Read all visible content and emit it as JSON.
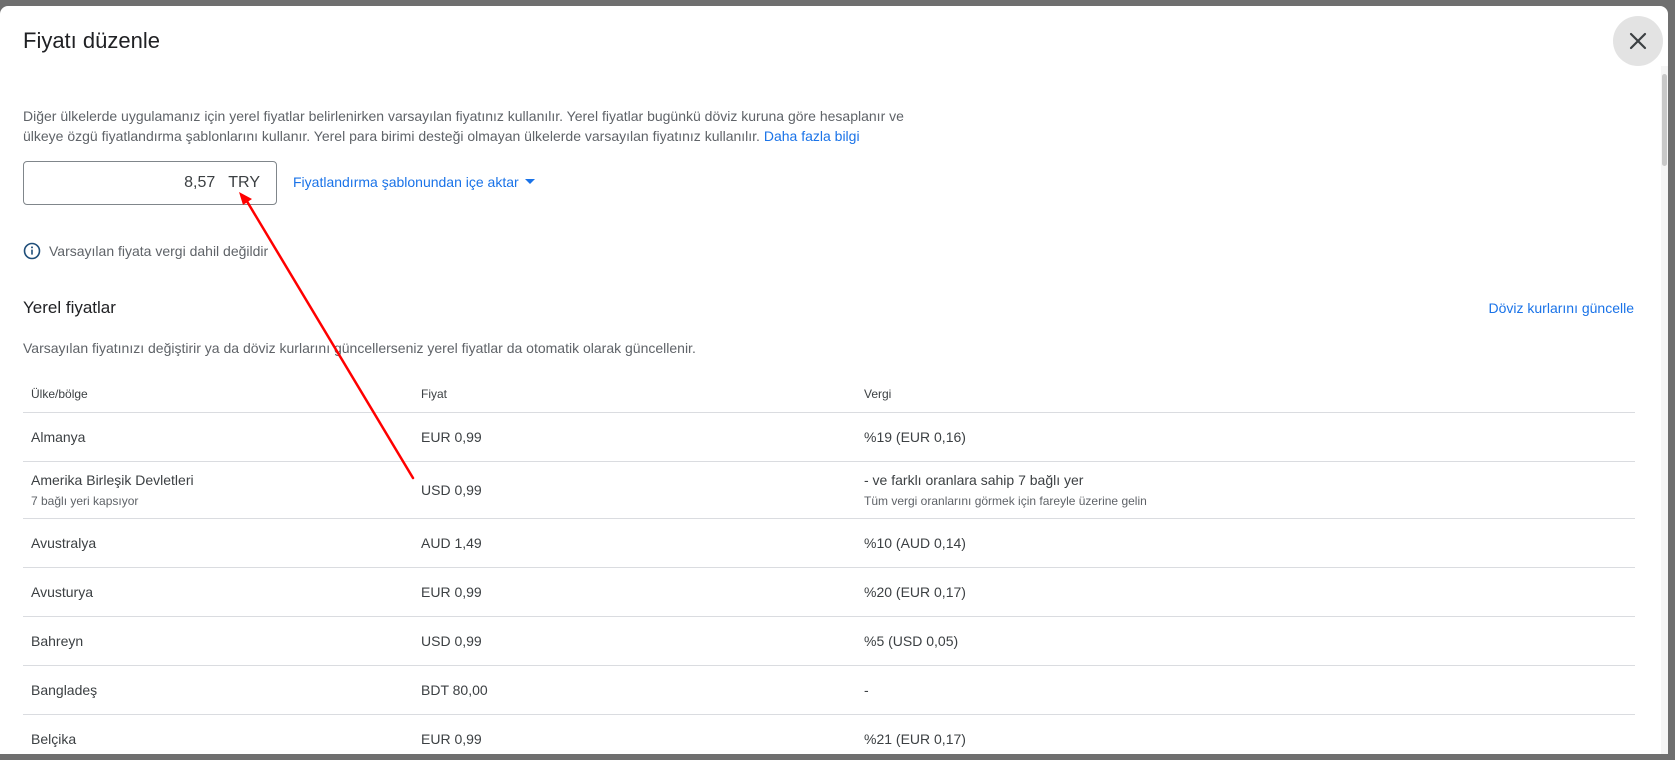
{
  "dialog": {
    "title": "Fiyatı düzenle",
    "description": "Diğer ülkelerde uygulamanız için yerel fiyatlar belirlenirken varsayılan fiyatınız kullanılır. Yerel fiyatlar bugünkü döviz kuruna göre hesaplanır ve ülkeye özgü fiyatlandırma şablonlarını kullanır. Yerel para birimi desteği olmayan ülkelerde varsayılan fiyatınız kullanılır.",
    "learn_more": "Daha fazla bilgi",
    "price_value": "8,57",
    "currency": "TRY",
    "import_template": "Fiyatlandırma şablonundan içe aktar",
    "tax_note": "Varsayılan fiyata vergi dahil değildir"
  },
  "local_prices": {
    "title": "Yerel fiyatlar",
    "update_rates": "Döviz kurlarını güncelle",
    "description": "Varsayılan fiyatınızı değiştirir ya da döviz kurlarını güncellerseniz yerel fiyatlar da otomatik olarak güncellenir.",
    "headers": [
      "Ülke/bölge",
      "Fiyat",
      "Vergi"
    ],
    "rows": [
      {
        "country": "Almanya",
        "price": "EUR 0,99",
        "tax": "%19 (EUR 0,16)"
      },
      {
        "country": "Amerika Birleşik Devletleri",
        "country_sub": "7 bağlı yeri kapsıyor",
        "price": "USD 0,99",
        "tax": "- ve farklı oranlara sahip 7 bağlı yer",
        "tax_sub": "Tüm vergi oranlarını görmek için fareyle üzerine gelin"
      },
      {
        "country": "Avustralya",
        "price": "AUD 1,49",
        "tax": "%10 (AUD 0,14)"
      },
      {
        "country": "Avusturya",
        "price": "EUR 0,99",
        "tax": "%20 (EUR 0,17)"
      },
      {
        "country": "Bahreyn",
        "price": "USD 0,99",
        "tax": "%5 (USD 0,05)"
      },
      {
        "country": "Bangladeş",
        "price": "BDT 80,00",
        "tax": "-"
      },
      {
        "country": "Belçika",
        "price": "EUR 0,99",
        "tax": "%21 (EUR 0,17)"
      }
    ]
  },
  "colors": {
    "link": "#1a73e8",
    "annotation_arrow": "#ff0000"
  },
  "icons": {
    "close": "close-icon",
    "info": "info-icon",
    "dropdown": "caret-down-icon"
  }
}
